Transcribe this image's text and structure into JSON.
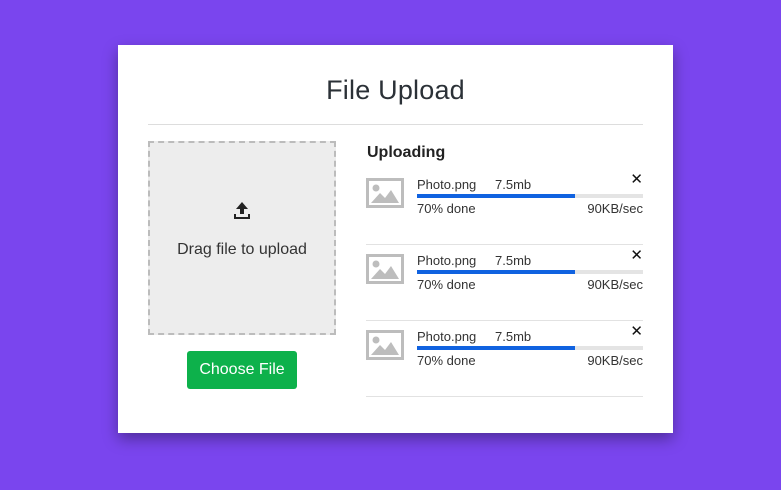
{
  "card": {
    "title": "File Upload"
  },
  "dropzone": {
    "icon": "upload-icon",
    "text": "Drag file to upload"
  },
  "choose_button": {
    "label": "Choose File",
    "color": "#0db14b"
  },
  "uploads": {
    "heading": "Uploading",
    "items": [
      {
        "icon": "image-icon",
        "name": "Photo.png",
        "size": "7.5mb",
        "progress": 0.7,
        "done_label": "70% done",
        "speed": "90KB/sec",
        "close_label": "✕"
      },
      {
        "icon": "image-icon",
        "name": "Photo.png",
        "size": "7.5mb",
        "progress": 0.7,
        "done_label": "70% done",
        "speed": "90KB/sec",
        "close_label": "✕"
      },
      {
        "icon": "image-icon",
        "name": "Photo.png",
        "size": "7.5mb",
        "progress": 0.7,
        "done_label": "70% done",
        "speed": "90KB/sec",
        "close_label": "✕"
      }
    ]
  },
  "colors": {
    "background": "#7a45ee",
    "progress": "#1062e0",
    "button": "#0db14b"
  }
}
